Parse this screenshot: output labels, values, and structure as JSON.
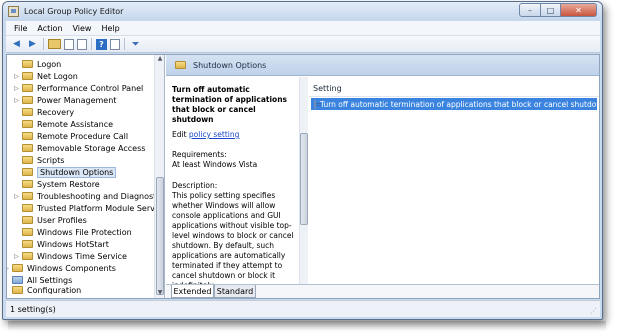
{
  "window": {
    "title": "Local Group Policy Editor",
    "controls": {
      "minimize": "–",
      "maximize": "□",
      "close": "✕"
    }
  },
  "menu": [
    "File",
    "Action",
    "View",
    "Help"
  ],
  "toolbar": {
    "icons": [
      "back-arrow-icon",
      "forward-arrow-icon",
      "up-folder-icon",
      "show-hide-tree-icon",
      "export-list-icon",
      "help-icon",
      "properties-icon",
      "filter-icon"
    ]
  },
  "tree": {
    "items": [
      {
        "label": "Logon",
        "expander": ""
      },
      {
        "label": "Net Logon",
        "expander": "▷"
      },
      {
        "label": "Performance Control Panel",
        "expander": "▷"
      },
      {
        "label": "Power Management",
        "expander": "▷"
      },
      {
        "label": "Recovery",
        "expander": ""
      },
      {
        "label": "Remote Assistance",
        "expander": ""
      },
      {
        "label": "Remote Procedure Call",
        "expander": ""
      },
      {
        "label": "Removable Storage Access",
        "expander": ""
      },
      {
        "label": "Scripts",
        "expander": ""
      },
      {
        "label": "Shutdown Options",
        "expander": "",
        "selected": true
      },
      {
        "label": "System Restore",
        "expander": ""
      },
      {
        "label": "Troubleshooting and Diagnostics",
        "expander": "▷"
      },
      {
        "label": "Trusted Platform Module Services",
        "expander": ""
      },
      {
        "label": "User Profiles",
        "expander": ""
      },
      {
        "label": "Windows File Protection",
        "expander": ""
      },
      {
        "label": "Windows HotStart",
        "expander": ""
      },
      {
        "label": "Windows Time Service",
        "expander": "▷"
      },
      {
        "label": "Windows Components",
        "expander": "▷"
      },
      {
        "label": "All Settings",
        "expander": ""
      },
      {
        "label": "Configuration",
        "expander": ""
      }
    ],
    "scroll_up": "▲",
    "scroll_down": "▼"
  },
  "banner": {
    "title": "Shutdown Options"
  },
  "description": {
    "title": "Turn off automatic termination of applications that block or cancel shutdown",
    "edit_prefix": "Edit ",
    "edit_link": "policy setting",
    "requirements_label": "Requirements:",
    "requirements_value": "At least Windows Vista",
    "description_label": "Description:",
    "description_text": "This policy setting specifies whether Windows will allow console applications and GUI applications without visible top-level windows to block or cancel shutdown. By default, such applications are automatically terminated if they attempt to cancel shutdown or block it indefinitely."
  },
  "list": {
    "column_header": "Setting",
    "rows": [
      "Turn off automatic termination of applications that block or cancel shutdown"
    ]
  },
  "tabs": {
    "extended": "Extended",
    "standard": "Standard"
  },
  "status": {
    "text": "1 setting(s)"
  },
  "colors": {
    "selection": "#3a84e0",
    "link": "#1a47c9",
    "banner": "#c8d8ee"
  }
}
